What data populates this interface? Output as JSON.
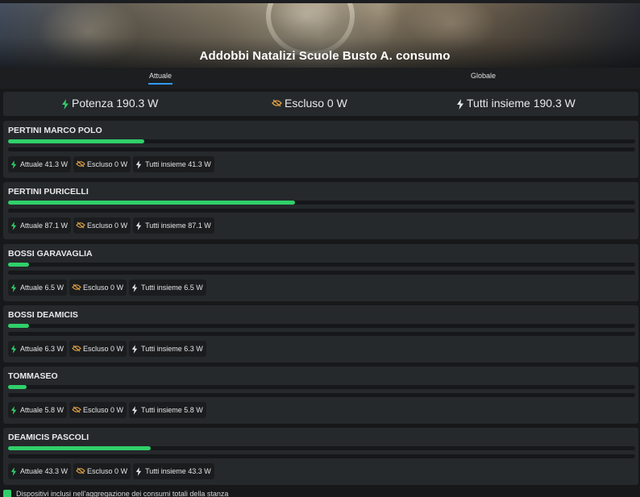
{
  "header": {
    "title": "Addobbi Natalizi Scuole Busto A. consumo"
  },
  "tabs": [
    {
      "label": "Attuale",
      "active": true
    },
    {
      "label": "Globale",
      "active": false
    }
  ],
  "summary": {
    "power": "Potenza 190.3 W",
    "excluded": "Escluso 0 W",
    "all": "Tutti insieme 190.3 W"
  },
  "colors": {
    "accent": "#2fd06a",
    "tab_underline": "#2f9bff",
    "excluded_icon": "#e0a244"
  },
  "rooms": [
    {
      "name": "PERTINI MARCO POLO",
      "fraction": 0.217,
      "current": "Attuale 41.3 W",
      "excluded": "Escluso 0 W",
      "all": "Tutti insieme 41.3 W"
    },
    {
      "name": "PERTINI PURICELLI",
      "fraction": 0.458,
      "current": "Attuale 87.1 W",
      "excluded": "Escluso 0 W",
      "all": "Tutti insieme 87.1 W"
    },
    {
      "name": "BOSSI GARAVAGLIA",
      "fraction": 0.034,
      "current": "Attuale 6.5 W",
      "excluded": "Escluso 0 W",
      "all": "Tutti insieme 6.5 W"
    },
    {
      "name": "BOSSI DEAMICIS",
      "fraction": 0.033,
      "current": "Attuale 6.3 W",
      "excluded": "Escluso 0 W",
      "all": "Tutti insieme 6.3 W"
    },
    {
      "name": "TOMMASEO",
      "fraction": 0.03,
      "current": "Attuale 5.8 W",
      "excluded": "Escluso 0 W",
      "all": "Tutti insieme 5.8 W"
    },
    {
      "name": "DEAMICIS PASCOLI",
      "fraction": 0.228,
      "current": "Attuale 43.3 W",
      "excluded": "Escluso 0 W",
      "all": "Tutti insieme 43.3 W"
    }
  ],
  "legend": {
    "label": "Dispositivi inclusi nell'aggregazione dei consumi totali della stanza"
  }
}
